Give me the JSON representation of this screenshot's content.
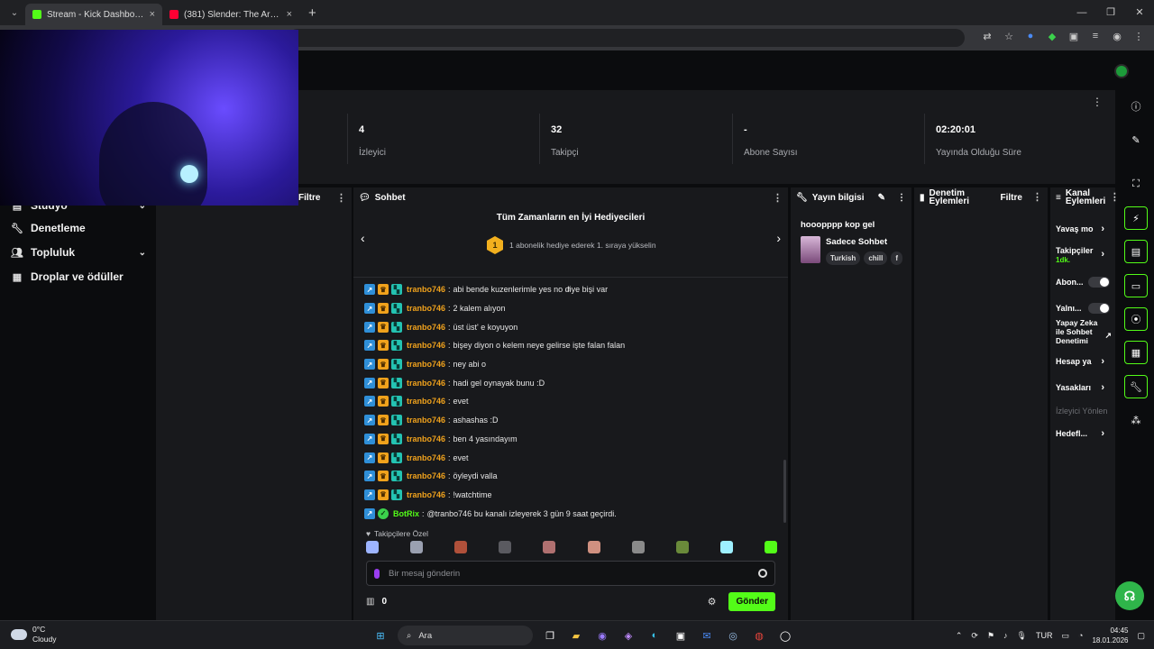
{
  "browser": {
    "tabs": [
      {
        "title": "Stream - Kick Dashboard",
        "color": "#53fc18"
      },
      {
        "title": "(381) Slender: The Arrival - İlk K",
        "color": "#ff0033"
      }
    ]
  },
  "stats": [
    {
      "value": "4",
      "label": "İzleyici"
    },
    {
      "value": "32",
      "label": "Takipçi"
    },
    {
      "value": "-",
      "label": "Abone Sayısı"
    },
    {
      "value": "02:20:01",
      "label": "Yayında Olduğu Süre"
    }
  ],
  "leftnav": [
    {
      "label": "Stüdyo",
      "icon": "studio-icon"
    },
    {
      "label": "Denetleme",
      "icon": "wrench-icon"
    },
    {
      "label": "Topluluk",
      "icon": "people-icon"
    },
    {
      "label": "Droplar ve ödüller",
      "icon": "gift-icon"
    }
  ],
  "panels": {
    "left_filter": "Filtre",
    "chat": "Sohbet",
    "info": "Yayın bilgisi",
    "mod": "Denetim Eylemleri",
    "mod_filter": "Filtre",
    "actions": "Kanal Eylemleri"
  },
  "gifters": {
    "title": "Tüm Zamanların en İyi Hediyecileri",
    "rank": "1",
    "hint": "1 abonelik hediye ederek 1. sıraya yükselin"
  },
  "messages": [
    {
      "user": "tranbo746",
      "text": "abi bende kuzenlerimle yes no diye bişi var"
    },
    {
      "user": "tranbo746",
      "text": "2 kalem alıyon"
    },
    {
      "user": "tranbo746",
      "text": "üst üst' e koyuyon"
    },
    {
      "user": "tranbo746",
      "text": "bişey diyon o kelem neye gelirse işte falan falan"
    },
    {
      "user": "tranbo746",
      "text": "ney abi o"
    },
    {
      "user": "tranbo746",
      "text": "hadi gel oynayak bunu :D"
    },
    {
      "user": "tranbo746",
      "text": "evet"
    },
    {
      "user": "tranbo746",
      "text": "ashashas :D"
    },
    {
      "user": "tranbo746",
      "text": "ben 4 yasındayım"
    },
    {
      "user": "tranbo746",
      "text": "evet"
    },
    {
      "user": "tranbo746",
      "text": "öyleydi valla"
    },
    {
      "user": "tranbo746",
      "text": "!watchtime"
    },
    {
      "user": "BotRix",
      "text": "@tranbo746 bu kanalı izleyerek 3 gün 9 saat geçirdi.",
      "bot": true
    }
  ],
  "colors": {
    "user": "#f0a21c",
    "bot": "#53fc18",
    "accent": "#53fc18"
  },
  "emote_label": "Takipçilere Özel",
  "emote_colors": [
    "#9db4ff",
    "#9aa0b0",
    "#b0503a",
    "#5a5a60",
    "#b07070",
    "#d09080",
    "#8a8a8a",
    "#6a8a3a",
    "#9ef0ff",
    "#53fc18"
  ],
  "chat_input": {
    "placeholder": "Bir mesaj gönderin"
  },
  "chat_footer": {
    "count": "0",
    "send": "Gönder"
  },
  "info": {
    "title": "hooopppp kop gel",
    "category": "Sadece Sohbet",
    "tags": [
      "Turkish",
      "chill",
      "f"
    ]
  },
  "actions": [
    {
      "label": "Yavaş mo",
      "kind": "chevron"
    },
    {
      "label": "Takipçiler",
      "sub": "1dk.",
      "kind": "chevron"
    },
    {
      "label": "Abon...",
      "kind": "toggle"
    },
    {
      "label": "Yalnı...",
      "kind": "toggle"
    },
    {
      "label": "Yapay Zeka ile Sohbet Denetimi",
      "kind": "chart"
    },
    {
      "label": "Hesap ya",
      "kind": "chevron"
    },
    {
      "label": "Yasakları",
      "kind": "chevron"
    },
    {
      "label": "İzleyici Yönlen",
      "kind": "dim"
    },
    {
      "label": "Hedefl...",
      "kind": "chevron"
    }
  ],
  "taskbar": {
    "weather_temp": "0°C",
    "weather_desc": "Cloudy",
    "search": "Ara",
    "lang": "TUR",
    "time": "04:45",
    "date": "18.01.2026"
  }
}
